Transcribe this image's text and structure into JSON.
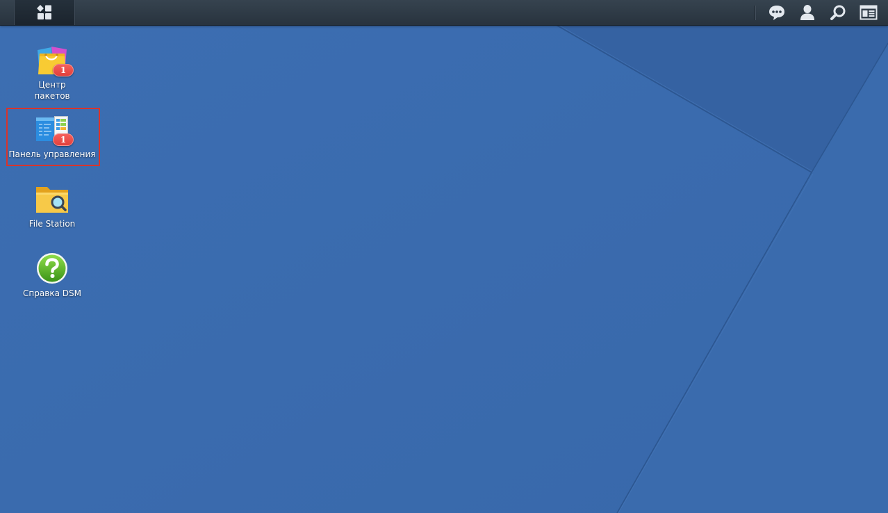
{
  "taskbar": {
    "main_menu": {
      "icon": "grid-icon"
    },
    "tray": [
      {
        "icon": "chat-icon"
      },
      {
        "icon": "user-icon"
      },
      {
        "icon": "search-icon"
      },
      {
        "icon": "widgets-icon"
      }
    ]
  },
  "desktop": {
    "shortcuts": [
      {
        "label": "Центр\nпакетов",
        "icon": "package-center-icon",
        "badge": "1"
      },
      {
        "label": "Панель управления",
        "icon": "control-panel-icon",
        "badge": "1",
        "highlighted": true
      },
      {
        "label": "File Station",
        "icon": "file-station-icon"
      },
      {
        "label": "Справка DSM",
        "icon": "help-icon"
      }
    ]
  },
  "colors": {
    "taskbar": "#2c3845",
    "wallpaper": "#3a6bae",
    "badge": "#e2403c",
    "highlight": "#d9342b",
    "label_text": "#ffffff"
  }
}
